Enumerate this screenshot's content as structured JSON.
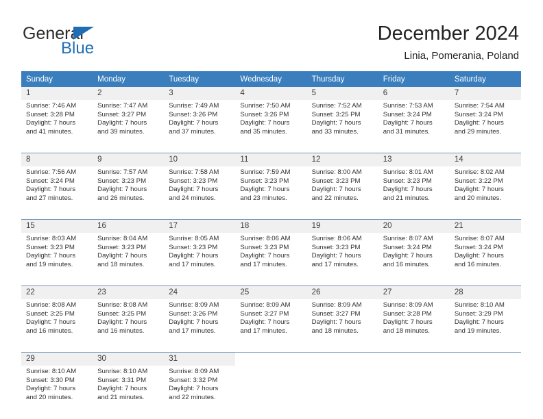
{
  "brand": {
    "name_part1": "General",
    "name_part2": "Blue",
    "logo_icon": "blue-triangle-icon"
  },
  "header": {
    "title": "December 2024",
    "subtitle": "Linia, Pomerania, Poland"
  },
  "colors": {
    "header_bar": "#3a7ebe",
    "brand_blue": "#1f6eb5",
    "daynum_bg": "#f0f0f0",
    "week_separator": "#6f93b4",
    "text": "#303030"
  },
  "weekday_headers": [
    "Sunday",
    "Monday",
    "Tuesday",
    "Wednesday",
    "Thursday",
    "Friday",
    "Saturday"
  ],
  "labels": {
    "sunrise": "Sunrise:",
    "sunset": "Sunset:",
    "daylight": "Daylight:"
  },
  "weeks": [
    {
      "days": [
        {
          "num": "1",
          "sunrise": "Sunrise: 7:46 AM",
          "sunset": "Sunset: 3:28 PM",
          "daylight1": "Daylight: 7 hours",
          "daylight2": "and 41 minutes."
        },
        {
          "num": "2",
          "sunrise": "Sunrise: 7:47 AM",
          "sunset": "Sunset: 3:27 PM",
          "daylight1": "Daylight: 7 hours",
          "daylight2": "and 39 minutes."
        },
        {
          "num": "3",
          "sunrise": "Sunrise: 7:49 AM",
          "sunset": "Sunset: 3:26 PM",
          "daylight1": "Daylight: 7 hours",
          "daylight2": "and 37 minutes."
        },
        {
          "num": "4",
          "sunrise": "Sunrise: 7:50 AM",
          "sunset": "Sunset: 3:26 PM",
          "daylight1": "Daylight: 7 hours",
          "daylight2": "and 35 minutes."
        },
        {
          "num": "5",
          "sunrise": "Sunrise: 7:52 AM",
          "sunset": "Sunset: 3:25 PM",
          "daylight1": "Daylight: 7 hours",
          "daylight2": "and 33 minutes."
        },
        {
          "num": "6",
          "sunrise": "Sunrise: 7:53 AM",
          "sunset": "Sunset: 3:24 PM",
          "daylight1": "Daylight: 7 hours",
          "daylight2": "and 31 minutes."
        },
        {
          "num": "7",
          "sunrise": "Sunrise: 7:54 AM",
          "sunset": "Sunset: 3:24 PM",
          "daylight1": "Daylight: 7 hours",
          "daylight2": "and 29 minutes."
        }
      ]
    },
    {
      "days": [
        {
          "num": "8",
          "sunrise": "Sunrise: 7:56 AM",
          "sunset": "Sunset: 3:24 PM",
          "daylight1": "Daylight: 7 hours",
          "daylight2": "and 27 minutes."
        },
        {
          "num": "9",
          "sunrise": "Sunrise: 7:57 AM",
          "sunset": "Sunset: 3:23 PM",
          "daylight1": "Daylight: 7 hours",
          "daylight2": "and 26 minutes."
        },
        {
          "num": "10",
          "sunrise": "Sunrise: 7:58 AM",
          "sunset": "Sunset: 3:23 PM",
          "daylight1": "Daylight: 7 hours",
          "daylight2": "and 24 minutes."
        },
        {
          "num": "11",
          "sunrise": "Sunrise: 7:59 AM",
          "sunset": "Sunset: 3:23 PM",
          "daylight1": "Daylight: 7 hours",
          "daylight2": "and 23 minutes."
        },
        {
          "num": "12",
          "sunrise": "Sunrise: 8:00 AM",
          "sunset": "Sunset: 3:23 PM",
          "daylight1": "Daylight: 7 hours",
          "daylight2": "and 22 minutes."
        },
        {
          "num": "13",
          "sunrise": "Sunrise: 8:01 AM",
          "sunset": "Sunset: 3:23 PM",
          "daylight1": "Daylight: 7 hours",
          "daylight2": "and 21 minutes."
        },
        {
          "num": "14",
          "sunrise": "Sunrise: 8:02 AM",
          "sunset": "Sunset: 3:22 PM",
          "daylight1": "Daylight: 7 hours",
          "daylight2": "and 20 minutes."
        }
      ]
    },
    {
      "days": [
        {
          "num": "15",
          "sunrise": "Sunrise: 8:03 AM",
          "sunset": "Sunset: 3:23 PM",
          "daylight1": "Daylight: 7 hours",
          "daylight2": "and 19 minutes."
        },
        {
          "num": "16",
          "sunrise": "Sunrise: 8:04 AM",
          "sunset": "Sunset: 3:23 PM",
          "daylight1": "Daylight: 7 hours",
          "daylight2": "and 18 minutes."
        },
        {
          "num": "17",
          "sunrise": "Sunrise: 8:05 AM",
          "sunset": "Sunset: 3:23 PM",
          "daylight1": "Daylight: 7 hours",
          "daylight2": "and 17 minutes."
        },
        {
          "num": "18",
          "sunrise": "Sunrise: 8:06 AM",
          "sunset": "Sunset: 3:23 PM",
          "daylight1": "Daylight: 7 hours",
          "daylight2": "and 17 minutes."
        },
        {
          "num": "19",
          "sunrise": "Sunrise: 8:06 AM",
          "sunset": "Sunset: 3:23 PM",
          "daylight1": "Daylight: 7 hours",
          "daylight2": "and 17 minutes."
        },
        {
          "num": "20",
          "sunrise": "Sunrise: 8:07 AM",
          "sunset": "Sunset: 3:24 PM",
          "daylight1": "Daylight: 7 hours",
          "daylight2": "and 16 minutes."
        },
        {
          "num": "21",
          "sunrise": "Sunrise: 8:07 AM",
          "sunset": "Sunset: 3:24 PM",
          "daylight1": "Daylight: 7 hours",
          "daylight2": "and 16 minutes."
        }
      ]
    },
    {
      "days": [
        {
          "num": "22",
          "sunrise": "Sunrise: 8:08 AM",
          "sunset": "Sunset: 3:25 PM",
          "daylight1": "Daylight: 7 hours",
          "daylight2": "and 16 minutes."
        },
        {
          "num": "23",
          "sunrise": "Sunrise: 8:08 AM",
          "sunset": "Sunset: 3:25 PM",
          "daylight1": "Daylight: 7 hours",
          "daylight2": "and 16 minutes."
        },
        {
          "num": "24",
          "sunrise": "Sunrise: 8:09 AM",
          "sunset": "Sunset: 3:26 PM",
          "daylight1": "Daylight: 7 hours",
          "daylight2": "and 17 minutes."
        },
        {
          "num": "25",
          "sunrise": "Sunrise: 8:09 AM",
          "sunset": "Sunset: 3:27 PM",
          "daylight1": "Daylight: 7 hours",
          "daylight2": "and 17 minutes."
        },
        {
          "num": "26",
          "sunrise": "Sunrise: 8:09 AM",
          "sunset": "Sunset: 3:27 PM",
          "daylight1": "Daylight: 7 hours",
          "daylight2": "and 18 minutes."
        },
        {
          "num": "27",
          "sunrise": "Sunrise: 8:09 AM",
          "sunset": "Sunset: 3:28 PM",
          "daylight1": "Daylight: 7 hours",
          "daylight2": "and 18 minutes."
        },
        {
          "num": "28",
          "sunrise": "Sunrise: 8:10 AM",
          "sunset": "Sunset: 3:29 PM",
          "daylight1": "Daylight: 7 hours",
          "daylight2": "and 19 minutes."
        }
      ]
    },
    {
      "days": [
        {
          "num": "29",
          "sunrise": "Sunrise: 8:10 AM",
          "sunset": "Sunset: 3:30 PM",
          "daylight1": "Daylight: 7 hours",
          "daylight2": "and 20 minutes."
        },
        {
          "num": "30",
          "sunrise": "Sunrise: 8:10 AM",
          "sunset": "Sunset: 3:31 PM",
          "daylight1": "Daylight: 7 hours",
          "daylight2": "and 21 minutes."
        },
        {
          "num": "31",
          "sunrise": "Sunrise: 8:09 AM",
          "sunset": "Sunset: 3:32 PM",
          "daylight1": "Daylight: 7 hours",
          "daylight2": "and 22 minutes."
        },
        null,
        null,
        null,
        null
      ]
    }
  ]
}
